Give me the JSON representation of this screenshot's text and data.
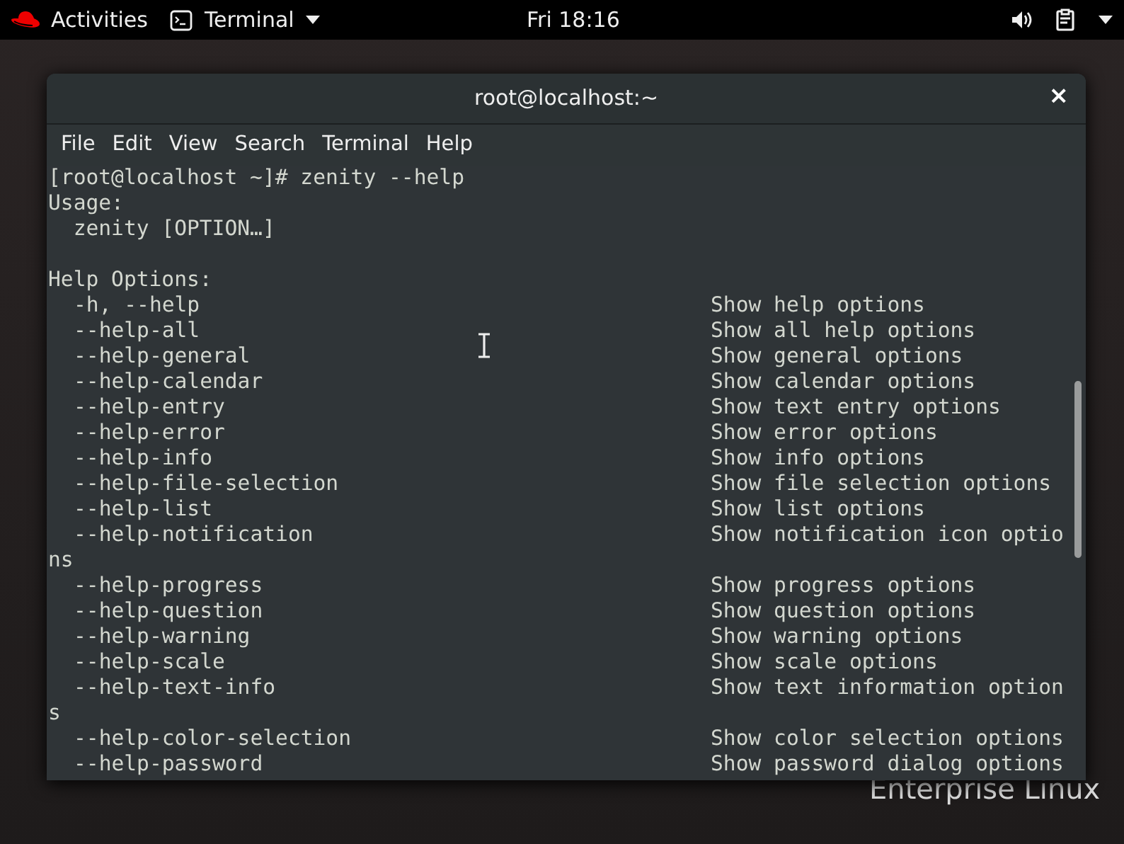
{
  "top_bar": {
    "activities": "Activities",
    "app_menu": "Terminal",
    "clock": "Fri 18:16"
  },
  "wallpaper": {
    "text": "Enterprise Linux"
  },
  "window": {
    "title": "root@localhost:~",
    "close": "×"
  },
  "menu": [
    "File",
    "Edit",
    "View",
    "Search",
    "Terminal",
    "Help"
  ],
  "terminal": {
    "lines": [
      {
        "kind": "text",
        "text": "[root@localhost ~]# zenity --help"
      },
      {
        "kind": "text",
        "text": "Usage:"
      },
      {
        "kind": "text",
        "text": "  zenity [OPTION…]"
      },
      {
        "kind": "blank"
      },
      {
        "kind": "text",
        "text": "Help Options:"
      },
      {
        "kind": "option",
        "option": "-h, --help",
        "description": "Show help options"
      },
      {
        "kind": "option",
        "option": "--help-all",
        "description": "Show all help options"
      },
      {
        "kind": "option",
        "option": "--help-general",
        "description": "Show general options"
      },
      {
        "kind": "option",
        "option": "--help-calendar",
        "description": "Show calendar options"
      },
      {
        "kind": "option",
        "option": "--help-entry",
        "description": "Show text entry options"
      },
      {
        "kind": "option",
        "option": "--help-error",
        "description": "Show error options"
      },
      {
        "kind": "option",
        "option": "--help-info",
        "description": "Show info options"
      },
      {
        "kind": "option",
        "option": "--help-file-selection",
        "description": "Show file selection options"
      },
      {
        "kind": "option",
        "option": "--help-list",
        "description": "Show list options"
      },
      {
        "kind": "option",
        "option": "--help-notification",
        "description": "Show notification icon optio"
      },
      {
        "kind": "text",
        "text": "ns"
      },
      {
        "kind": "option",
        "option": "--help-progress",
        "description": "Show progress options"
      },
      {
        "kind": "option",
        "option": "--help-question",
        "description": "Show question options"
      },
      {
        "kind": "option",
        "option": "--help-warning",
        "description": "Show warning options"
      },
      {
        "kind": "option",
        "option": "--help-scale",
        "description": "Show scale options"
      },
      {
        "kind": "option",
        "option": "--help-text-info",
        "description": "Show text information option"
      },
      {
        "kind": "text",
        "text": "s"
      },
      {
        "kind": "option",
        "option": "--help-color-selection",
        "description": "Show color selection options"
      },
      {
        "kind": "option",
        "option": "--help-password",
        "description": "Show password dialog options"
      }
    ]
  }
}
